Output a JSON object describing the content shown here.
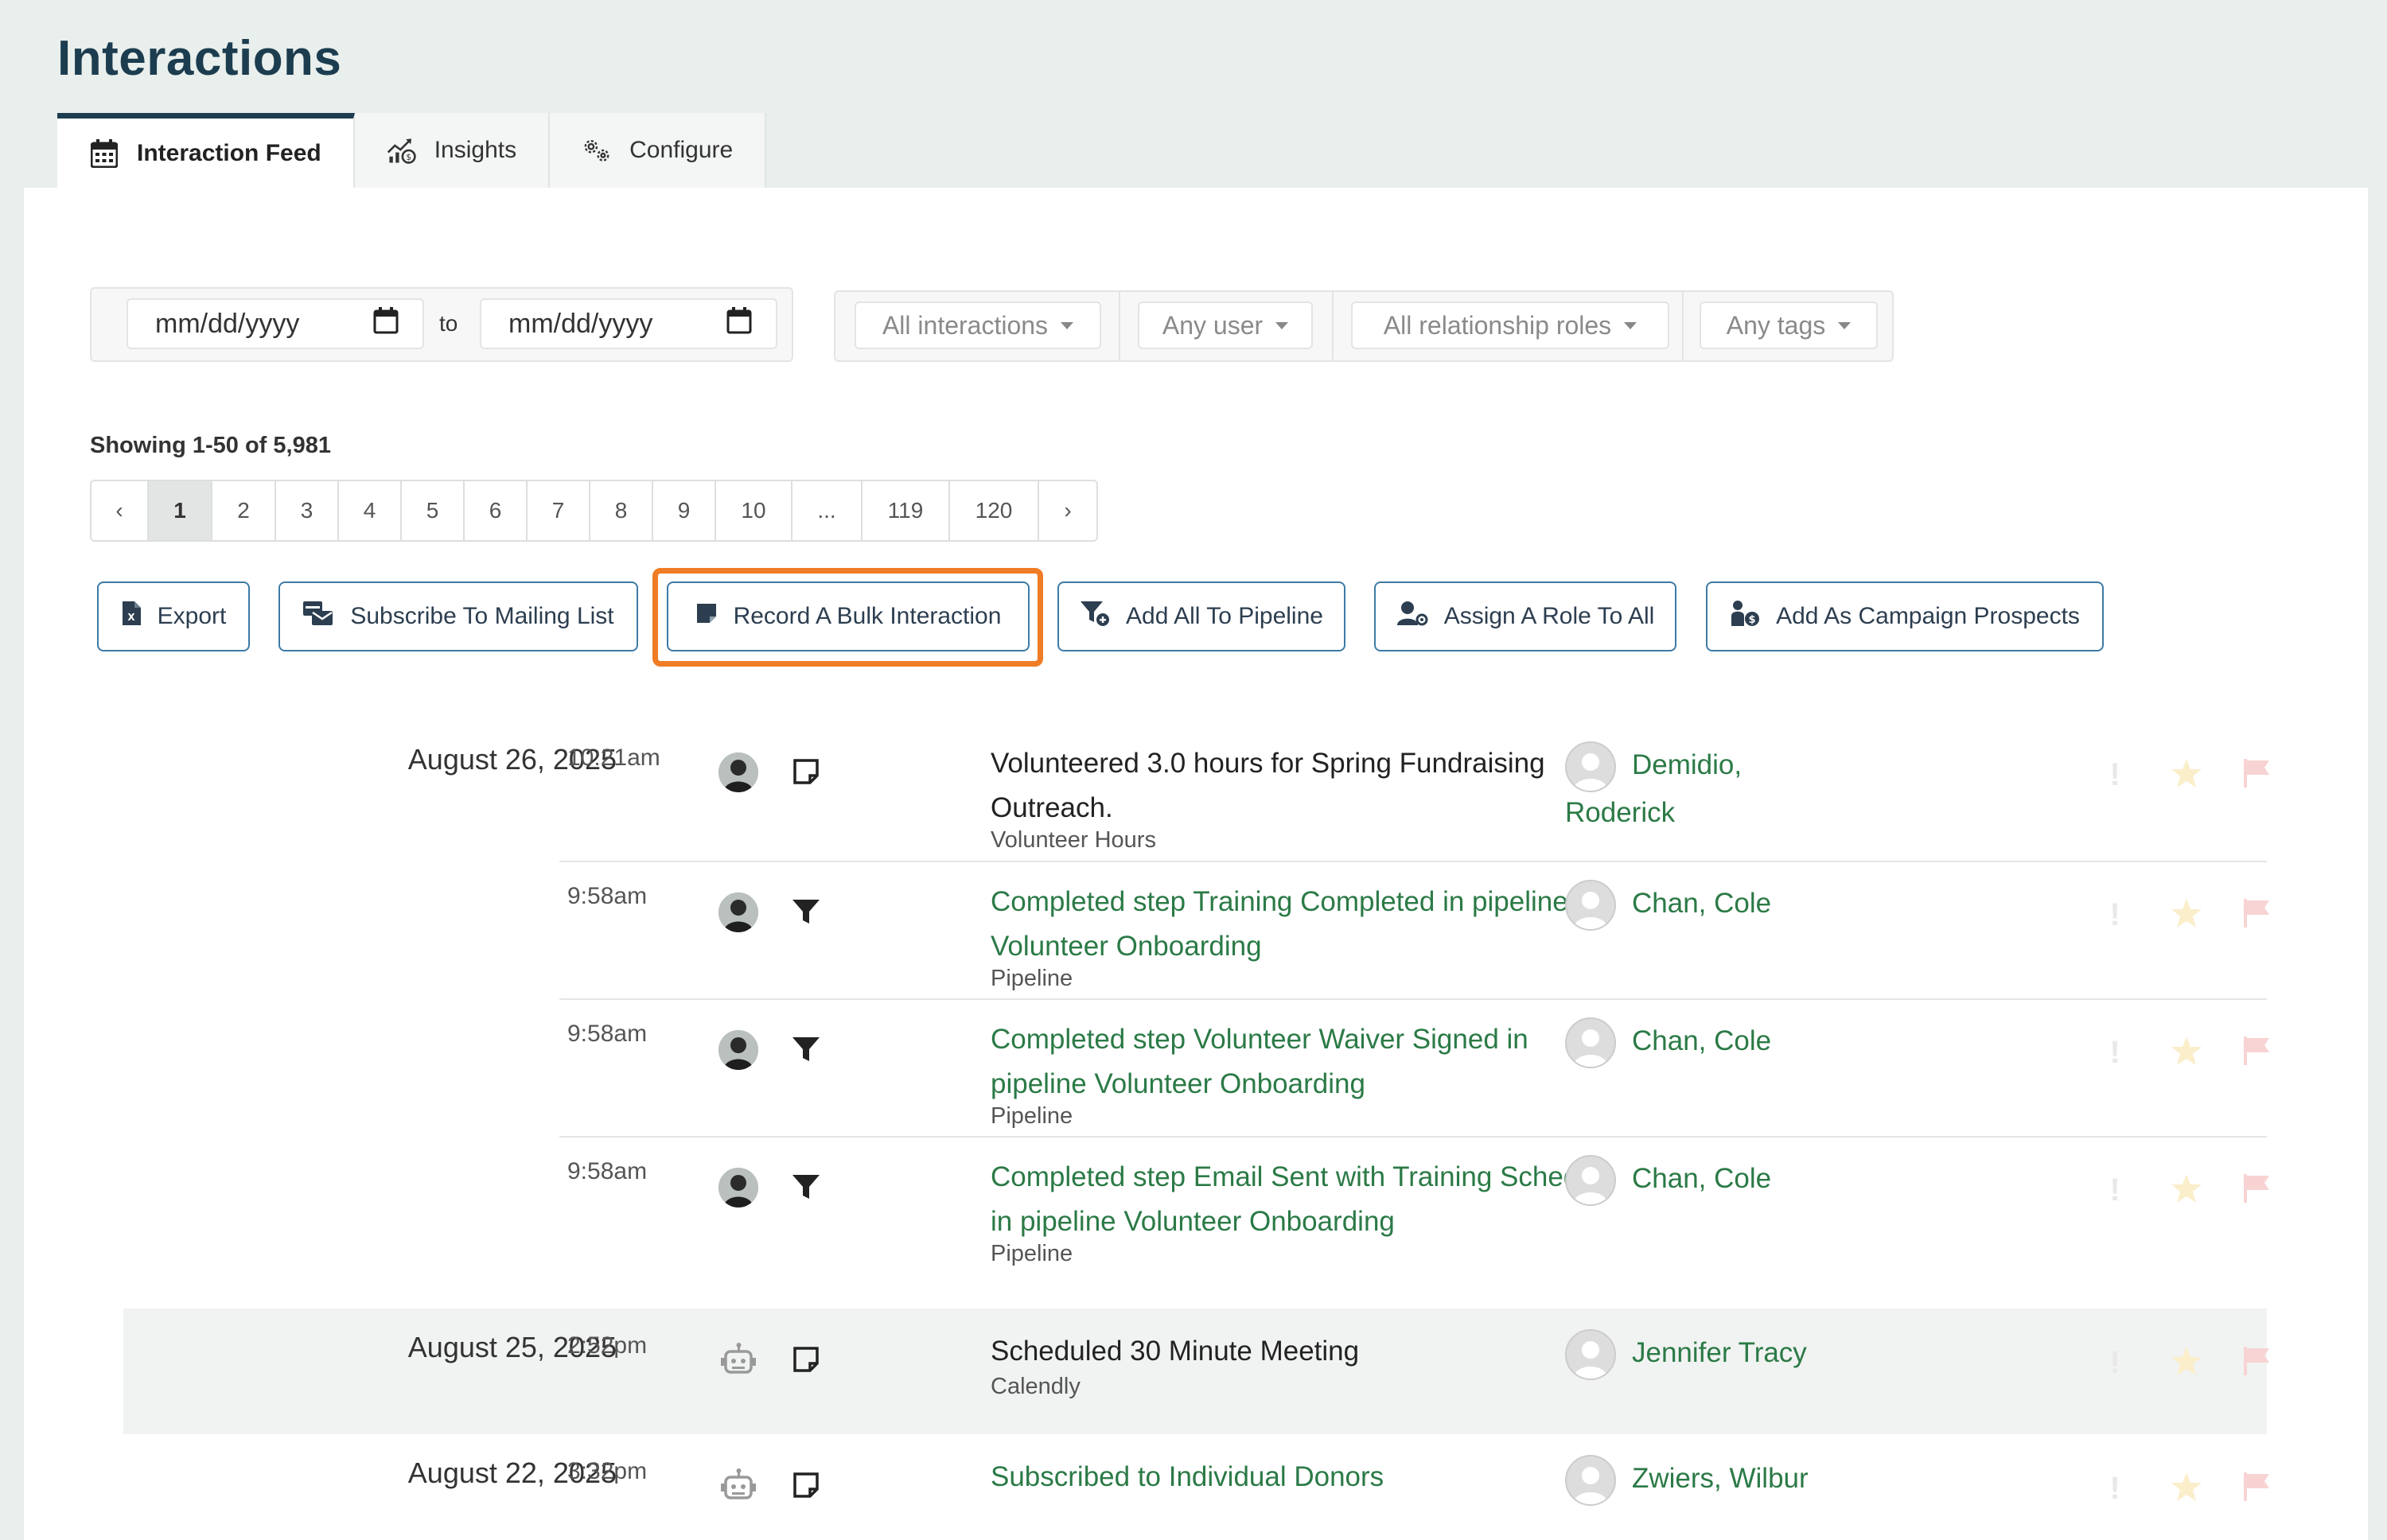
{
  "page": {
    "title": "Interactions"
  },
  "tabs": [
    {
      "label": "Interaction Feed",
      "icon": "calendar-icon",
      "active": true
    },
    {
      "label": "Insights",
      "icon": "chart-growth-icon",
      "active": false
    },
    {
      "label": "Configure",
      "icon": "gears-icon",
      "active": false
    }
  ],
  "filters": {
    "date_from_placeholder": "mm/dd/yyyy",
    "date_to_label": "to",
    "date_to_placeholder": "mm/dd/yyyy",
    "interactions": "All interactions",
    "user": "Any user",
    "roles": "All relationship roles",
    "tags": "Any tags"
  },
  "results": {
    "showing": "Showing 1-50 of 5,981",
    "pages": [
      "‹",
      "1",
      "2",
      "3",
      "4",
      "5",
      "6",
      "7",
      "8",
      "9",
      "10",
      "...",
      "119",
      "120",
      "›"
    ],
    "active_page": "1"
  },
  "actions": {
    "export": "Export",
    "subscribe": "Subscribe To Mailing List",
    "bulk": "Record A Bulk Interaction",
    "pipeline": "Add All To Pipeline",
    "role": "Assign A Role To All",
    "campaign": "Add As Campaign Prospects"
  },
  "feed": [
    {
      "date": "August 26, 2025",
      "time": "10:21am",
      "user_type": "person",
      "type_icon": "note-icon",
      "description": "Volunteered 3.0 hours for Spring Fundraising Outreach.",
      "is_link": false,
      "category": "Volunteer Hours",
      "person": "Demidio, Roderick"
    },
    {
      "date": "",
      "time": "9:58am",
      "user_type": "person",
      "type_icon": "funnel-icon",
      "description": "Completed step Training Completed in pipeline Volunteer Onboarding",
      "is_link": true,
      "category": "Pipeline",
      "person": "Chan, Cole"
    },
    {
      "date": "",
      "time": "9:58am",
      "user_type": "person",
      "type_icon": "funnel-icon",
      "description": "Completed step Volunteer Waiver Signed in pipeline Volunteer Onboarding",
      "is_link": true,
      "category": "Pipeline",
      "person": "Chan, Cole"
    },
    {
      "date": "",
      "time": "9:58am",
      "user_type": "person",
      "type_icon": "funnel-icon",
      "description": "Completed step Email Sent with Training Schedule in pipeline Volunteer Onboarding",
      "is_link": true,
      "category": "Pipeline",
      "person": "Chan, Cole"
    },
    {
      "date": "August 25, 2025",
      "time": "2:52pm",
      "user_type": "robot",
      "type_icon": "note-icon",
      "description": "Scheduled 30 Minute Meeting",
      "is_link": false,
      "category": "Calendly",
      "person": "Jennifer Tracy"
    },
    {
      "date": "August 22, 2025",
      "time": "3:32pm",
      "user_type": "robot",
      "type_icon": "note-icon",
      "description": "Subscribed to Individual Donors",
      "is_link": true,
      "category": "",
      "person": "Zwiers, Wilbur"
    }
  ],
  "row_icons": {
    "exclaim": "!",
    "star_color": "#fbeecb",
    "flag_color": "#f8d3d3"
  },
  "colors": {
    "brand": "#1c3d4f",
    "link": "#2b7a46",
    "button_border": "#3d7aa6",
    "highlight": "#f07c25"
  }
}
